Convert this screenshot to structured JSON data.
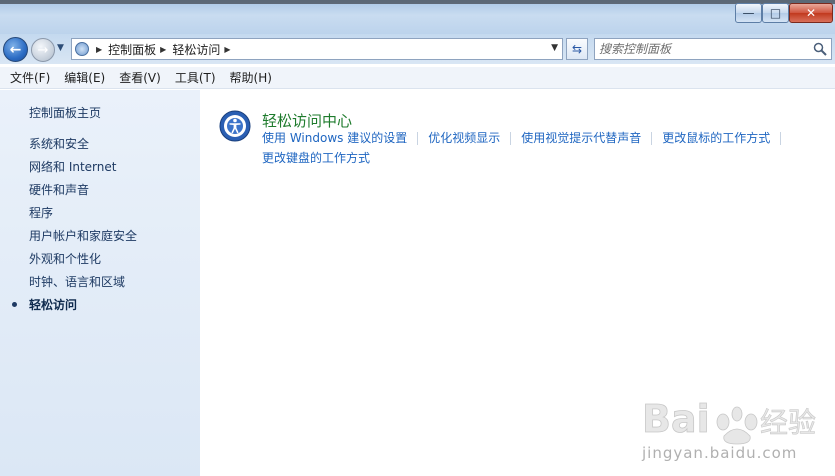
{
  "window": {
    "minimize_glyph": "—",
    "maximize_glyph": "□",
    "close_glyph": "✕"
  },
  "nav": {
    "back_glyph": "←",
    "forward_glyph": "→",
    "breadcrumbs": [
      "控制面板",
      "轻松访问"
    ],
    "search_placeholder": "搜索控制面板"
  },
  "menu": {
    "items": [
      "文件(F)",
      "编辑(E)",
      "查看(V)",
      "工具(T)",
      "帮助(H)"
    ]
  },
  "sidebar": {
    "home": "控制面板主页",
    "items": [
      "系统和安全",
      "网络和 Internet",
      "硬件和声音",
      "程序",
      "用户帐户和家庭安全",
      "外观和个性化",
      "时钟、语言和区域",
      "轻松访问"
    ],
    "current_index": 7
  },
  "main": {
    "icon": "ease-of-access-icon",
    "title": "轻松访问中心",
    "links": [
      "使用 Windows 建议的设置",
      "优化视频显示",
      "使用视觉提示代替声音",
      "更改鼠标的工作方式",
      "更改键盘的工作方式"
    ]
  },
  "watermark": {
    "text": "jingyan.baidu.com"
  },
  "colors": {
    "title_green": "#1e7b2c",
    "link_blue": "#1f66c1",
    "sidebar_text": "#1e3a63"
  }
}
